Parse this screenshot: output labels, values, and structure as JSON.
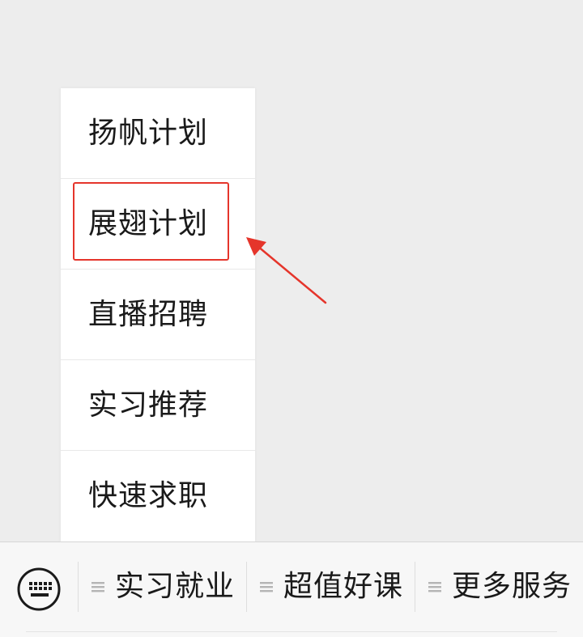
{
  "submenu": {
    "items": [
      {
        "label": "扬帆计划"
      },
      {
        "label": "展翅计划"
      },
      {
        "label": "直播招聘"
      },
      {
        "label": "实习推荐"
      },
      {
        "label": "快速求职"
      }
    ],
    "highlighted_item": "展翅计划"
  },
  "bottom_menu": {
    "keyboard_icon": "keyboard-icon",
    "tabs": [
      {
        "label": "实习就业",
        "icon": "menu-lines-icon"
      },
      {
        "label": "超值好课",
        "icon": "menu-lines-icon"
      },
      {
        "label": "更多服务",
        "icon": "menu-lines-icon"
      }
    ]
  },
  "colors": {
    "background": "#ededed",
    "panel": "#ffffff",
    "highlight": "#e5352b",
    "text": "#1a1a1a"
  }
}
